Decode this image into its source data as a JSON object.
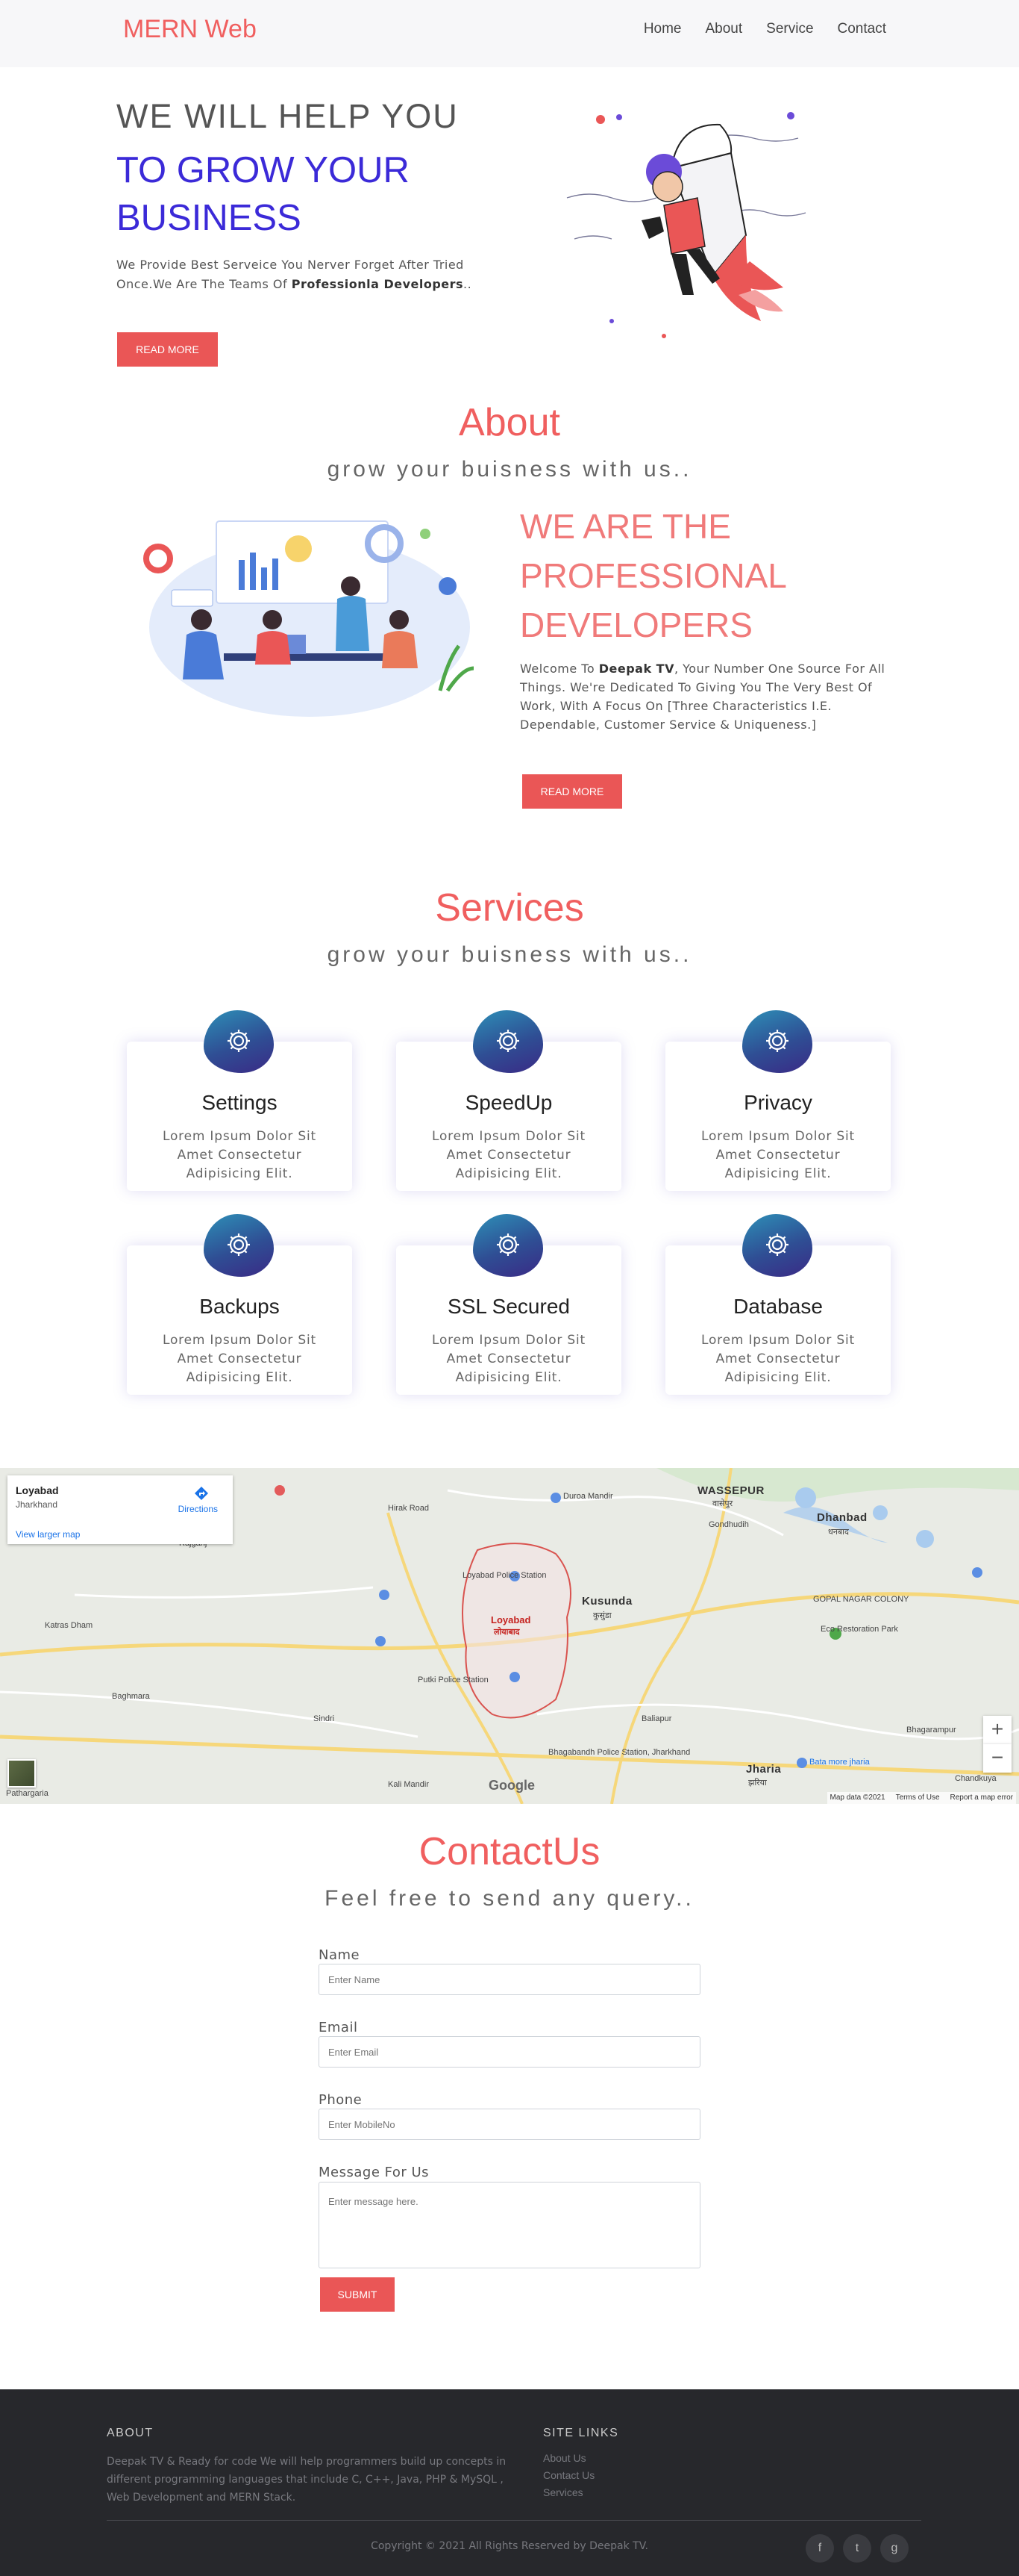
{
  "nav": {
    "brand": "MERN Web",
    "links": [
      "Home",
      "About",
      "Service",
      "Contact"
    ]
  },
  "hero": {
    "line1": "WE WILL HELP YOU",
    "line2": "TO GROW YOUR BUSINESS",
    "sub_pre": "We Provide Best Serveice You Nerver Forget After Tried Once.We Are The Teams Of ",
    "sub_bold": "Professionla Developers",
    "sub_post": "..",
    "button": "READ MORE"
  },
  "about": {
    "title": "About",
    "subtitle": "grow your buisness with us..",
    "heading": "WE ARE THE PROFESSIONAL DEVELOPERS",
    "text_pre": "Welcome To ",
    "text_bold": "Deepak TV",
    "text_post": ", Your Number One Source For All Things. We're Dedicated To Giving You The Very Best Of Work, With A Focus On [Three Characteristics I.E. Dependable, Customer Service & Uniqueness.]",
    "button": "READ MORE"
  },
  "services": {
    "title": "Services",
    "subtitle": "grow your buisness with us..",
    "items": [
      {
        "title": "Settings",
        "desc": "Lorem Ipsum Dolor Sit Amet Consectetur Adipisicing Elit.",
        "icon": "gear-icon"
      },
      {
        "title": "SpeedUp",
        "desc": "Lorem Ipsum Dolor Sit Amet Consectetur Adipisicing Elit.",
        "icon": "gear-icon"
      },
      {
        "title": "Privacy",
        "desc": "Lorem Ipsum Dolor Sit Amet Consectetur Adipisicing Elit.",
        "icon": "gear-icon"
      },
      {
        "title": "Backups",
        "desc": "Lorem Ipsum Dolor Sit Amet Consectetur Adipisicing Elit.",
        "icon": "gear-icon"
      },
      {
        "title": "SSL Secured",
        "desc": "Lorem Ipsum Dolor Sit Amet Consectetur Adipisicing Elit.",
        "icon": "gear-icon"
      },
      {
        "title": "Database",
        "desc": "Lorem Ipsum Dolor Sit Amet Consectetur Adipisicing Elit.",
        "icon": "gear-icon"
      }
    ]
  },
  "map": {
    "place": "Loyabad",
    "region": "Jharkhand",
    "directions": "Directions",
    "larger_map": "View larger map",
    "zoom_in": "+",
    "zoom_out": "−",
    "google": "Google",
    "footer": [
      "Map data ©2021",
      "Terms of Use",
      "Report a map error"
    ],
    "labels": {
      "wassepur": "WASSEPUR",
      "wassepur_hi": "वासेपुर",
      "dhanbad": "Dhanbad",
      "dhanbad_hi": "धनबाद",
      "kusunda": "Kusunda",
      "kusunda_hi": "कुसुंडा",
      "jharia": "Jharia",
      "jharia_hi": "झरिया",
      "loyabad": "Loyabad",
      "loyabad_hi": "लोयाबाद",
      "police": "Loyabad Police Station",
      "putki": "Putki Police Station",
      "gopal": "GOPAL NAGAR COLONY",
      "eco": "Eco Restoration Park",
      "katras": "Katras Dham",
      "rajganj": "Rajganj",
      "baghmara": "Baghmara",
      "sindri": "Sindri",
      "patharguri": "Pathargaria",
      "kalimandir": "Kali Mandir",
      "baliapur": "Baliapur",
      "duroa": "Duroa Mandir",
      "gondhudih": "Gondhudih",
      "hirak": "Hirak Road",
      "bhagabandh": "Bhagabandh Police Station, Jharkhand",
      "bata": "Bata more jharia",
      "chandkuya": "Chandkuya",
      "bhagaramp": "Bhagarampur"
    }
  },
  "contact": {
    "title": "ContactUs",
    "subtitle": "Feel free to send any query..",
    "fields": [
      {
        "label": "Name",
        "placeholder": "Enter Name"
      },
      {
        "label": "Email",
        "placeholder": "Enter Email"
      },
      {
        "label": "Phone",
        "placeholder": "Enter MobileNo"
      }
    ],
    "message_label": "Message For Us",
    "message_placeholder": "Enter message here.",
    "submit": "SUBMIT"
  },
  "footer": {
    "about_title": "ABOUT",
    "about_text": "Deepak TV & Ready for code We will help programmers build up concepts in different programming languages that include C, C++, Java, PHP & MySQL , Web Development and MERN Stack.",
    "links_title": "SITE LINKS",
    "links": [
      "About Us",
      "Contact Us",
      "Services"
    ],
    "copyright": "Copyright © 2021 All Rights Reserved by Deepak TV.",
    "social": [
      {
        "icon": "facebook-icon",
        "glyph": "f"
      },
      {
        "icon": "twitter-icon",
        "glyph": "t"
      },
      {
        "icon": "github-icon",
        "glyph": "g"
      }
    ]
  },
  "colors": {
    "accent": "#f05f5f",
    "hero_blue": "#3b2ad8",
    "button": "#ea5656",
    "footer_bg": "#27282c"
  }
}
